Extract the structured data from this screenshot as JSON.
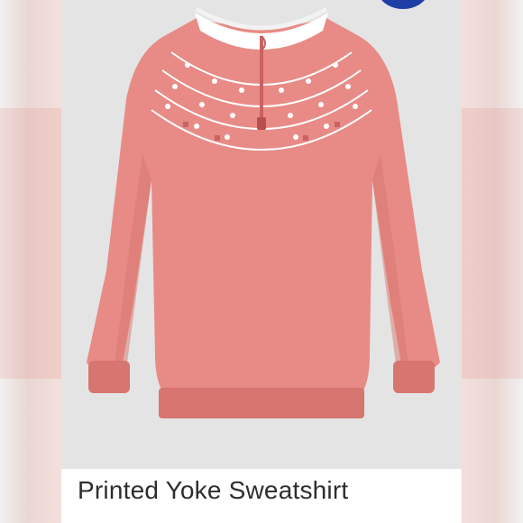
{
  "product": {
    "title": "Printed Yoke Sweatshirt",
    "image_subject": "pink quarter-zip sweatshirt with printed yoke",
    "colors": {
      "garment": "#e88b86",
      "garment_shadow": "#d77570",
      "pattern": "#ffffff",
      "pattern_accent": "#c96262",
      "collar": "#ffffff",
      "background": "#e4e4e4",
      "badge": "#1f3fa6"
    }
  }
}
